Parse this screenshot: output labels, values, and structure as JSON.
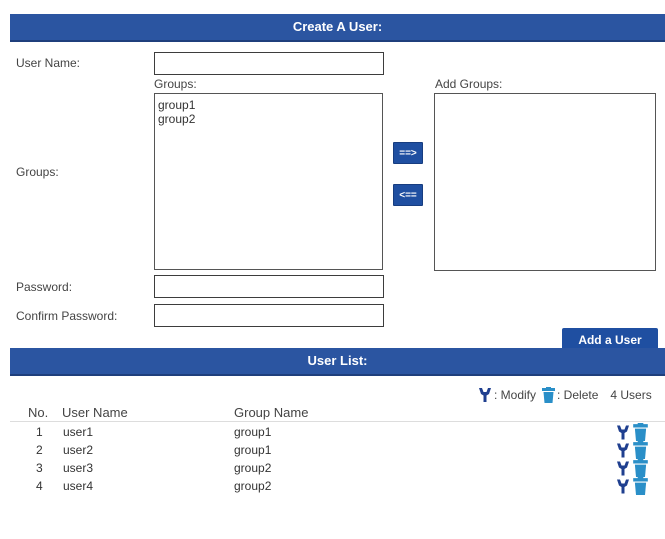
{
  "create_user": {
    "title": "Create A User:",
    "user_name_label": "User Name:",
    "user_name_value": "",
    "groups_label": "Groups:",
    "groups_list_label": "Groups:",
    "available_groups": [
      "group1",
      "group2"
    ],
    "add_groups_label": "Add Groups:",
    "added_groups": [],
    "add_arrow_label": "==>",
    "remove_arrow_label": "<==",
    "password_label": "Password:",
    "password_value": "",
    "confirm_password_label": "Confirm Password:",
    "confirm_password_value": "",
    "add_user_button": "Add a User"
  },
  "user_list": {
    "title": "User List:",
    "legend": {
      "modify_label": ": Modify",
      "delete_label": ": Delete",
      "count_label": "4 Users",
      "modify_icon": "wrench-icon",
      "delete_icon": "trash-icon"
    },
    "columns": {
      "no": "No.",
      "user_name": "User Name",
      "group_name": "Group Name"
    },
    "rows": [
      {
        "no": "1",
        "user": "user1",
        "group": "group1"
      },
      {
        "no": "2",
        "user": "user2",
        "group": "group1"
      },
      {
        "no": "3",
        "user": "user3",
        "group": "group2"
      },
      {
        "no": "4",
        "user": "user4",
        "group": "group2"
      }
    ]
  },
  "colors": {
    "header_bar": "#2b55a1",
    "button": "#1f4fa1",
    "wrench_icon": "#1f3f8f",
    "trash_icon": "#2a8fc8"
  }
}
